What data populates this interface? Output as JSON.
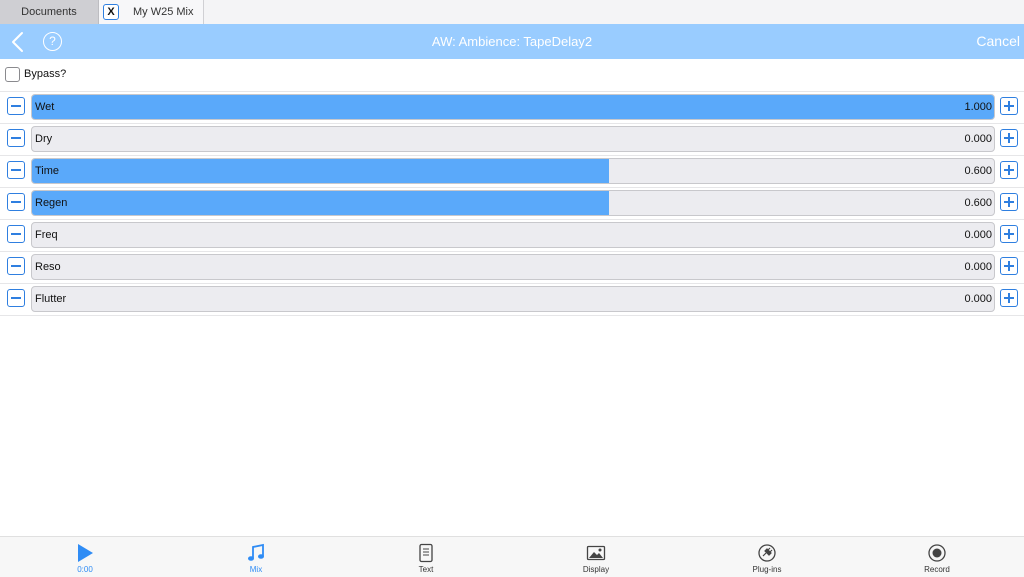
{
  "tabs": {
    "documents": "Documents",
    "close_glyph": "X",
    "mix": "My W25 Mix"
  },
  "header": {
    "title": "AW: Ambience: TapeDelay2",
    "help_glyph": "?",
    "cancel": "Cancel",
    "accent": "#99ccff"
  },
  "bypass": {
    "label": "Bypass?",
    "checked": false
  },
  "params": [
    {
      "label": "Wet",
      "value": "1.000",
      "level": 1.0
    },
    {
      "label": "Dry",
      "value": "0.000",
      "level": 0.0
    },
    {
      "label": "Time",
      "value": "0.600",
      "level": 0.6
    },
    {
      "label": "Regen",
      "value": "0.600",
      "level": 0.6
    },
    {
      "label": "Freq",
      "value": "0.000",
      "level": 0.0
    },
    {
      "label": "Reso",
      "value": "0.000",
      "level": 0.0
    },
    {
      "label": "Flutter",
      "value": "0.000",
      "level": 0.0
    }
  ],
  "toolbar": {
    "items": [
      {
        "label": "0:00",
        "icon": "play-icon",
        "active": true
      },
      {
        "label": "Mix",
        "icon": "music-note-icon",
        "active": true
      },
      {
        "label": "Text",
        "icon": "document-icon",
        "active": false
      },
      {
        "label": "Display",
        "icon": "image-icon",
        "active": false
      },
      {
        "label": "Plug-ins",
        "icon": "plug-icon",
        "active": false
      },
      {
        "label": "Record",
        "icon": "record-icon",
        "active": false
      }
    ]
  }
}
